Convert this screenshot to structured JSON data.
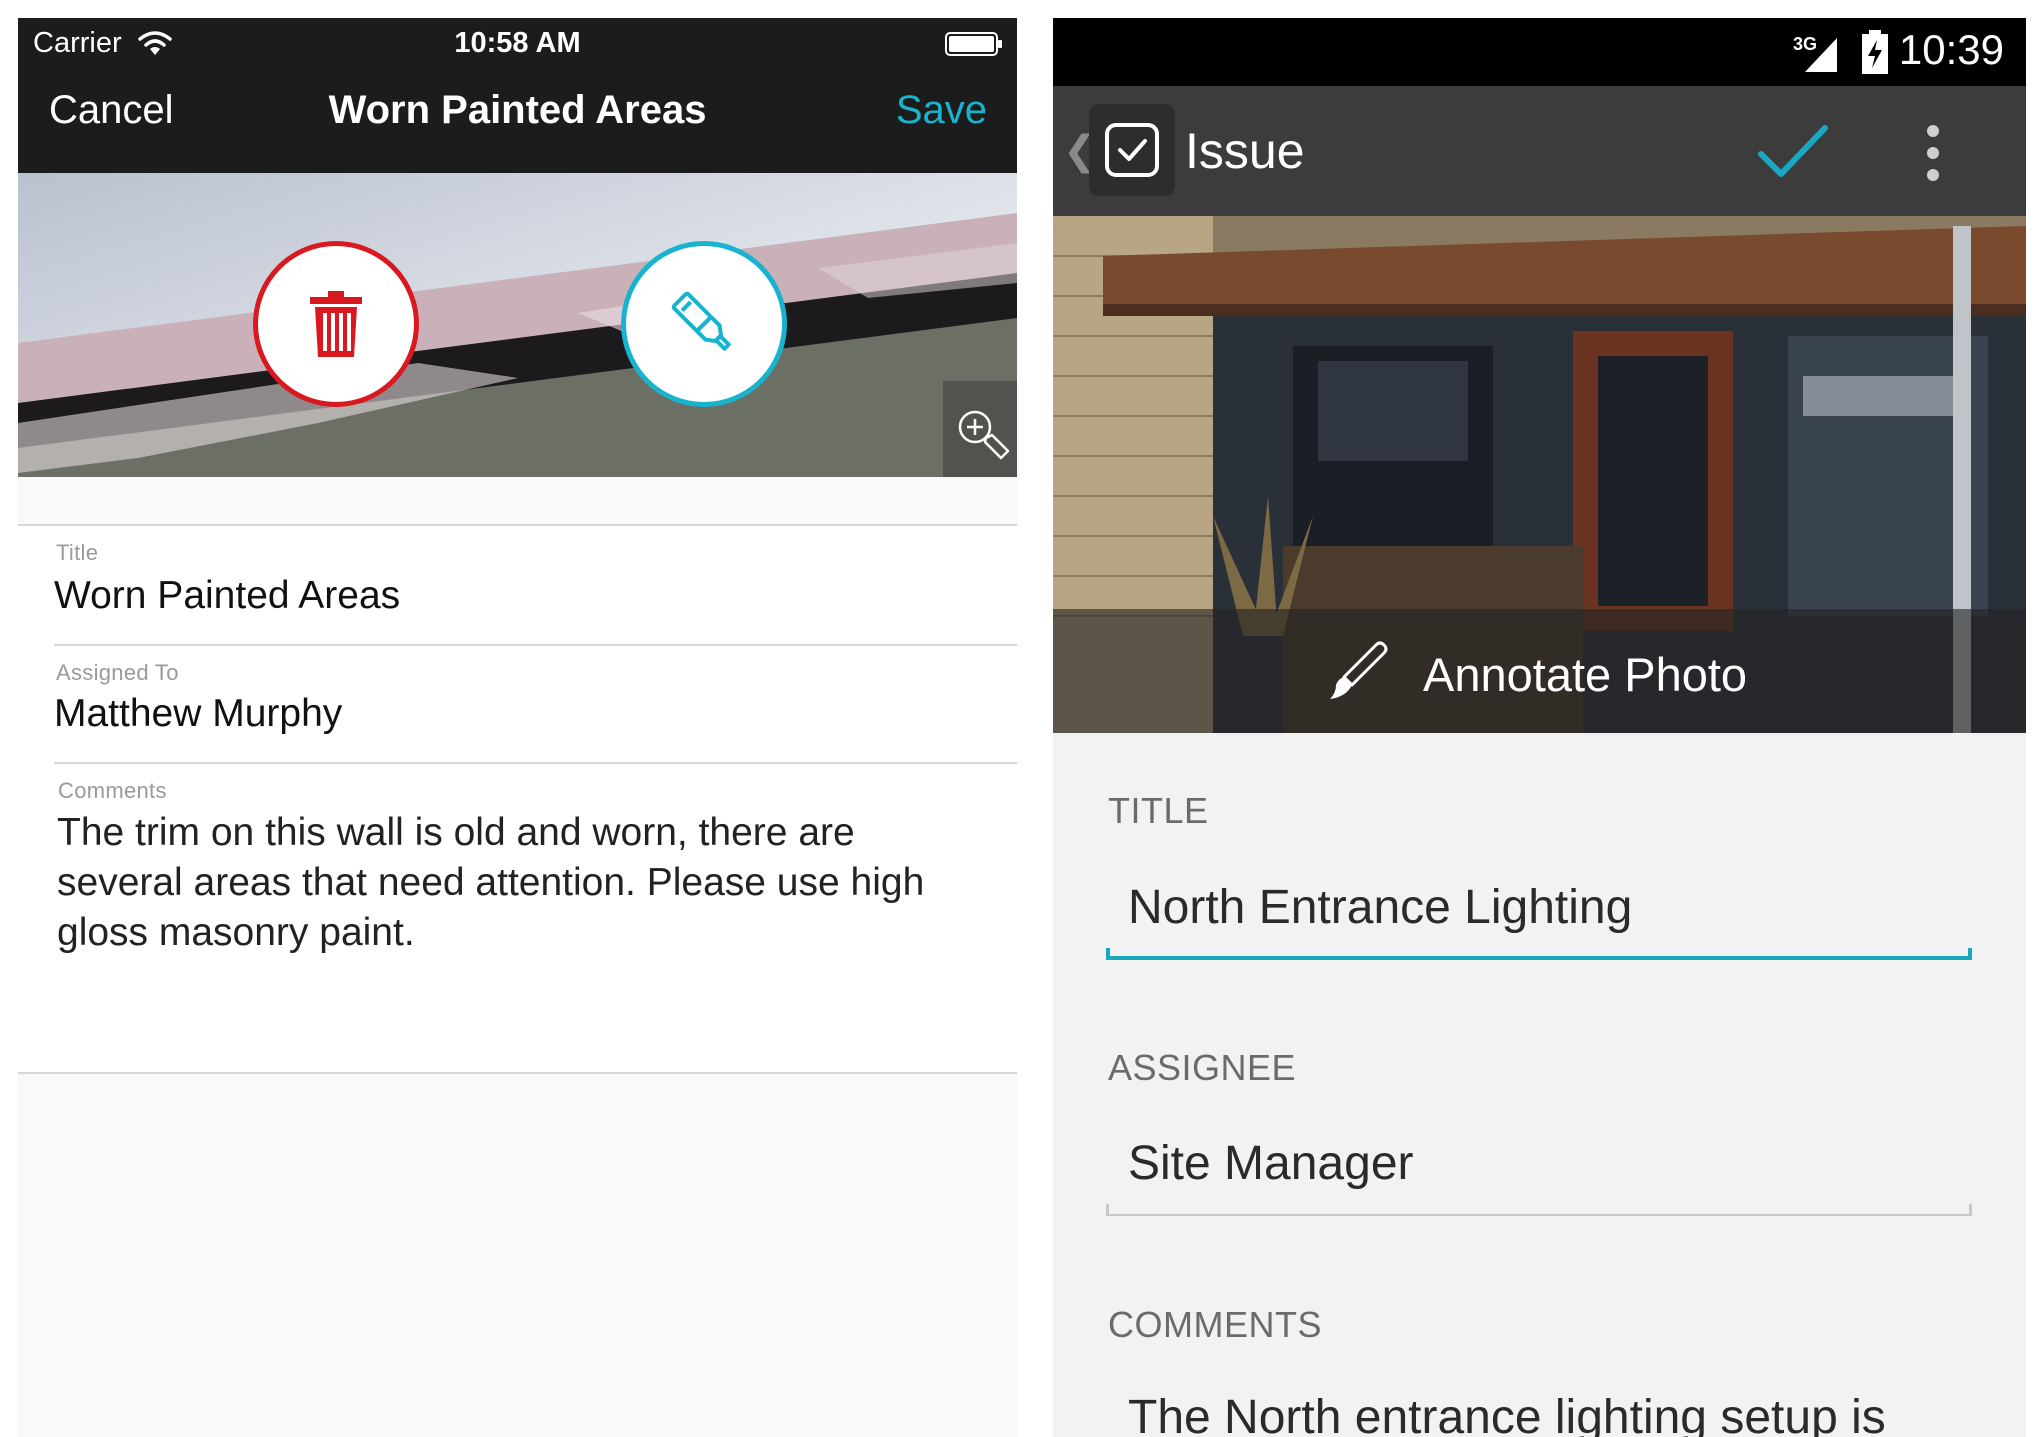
{
  "ios": {
    "status": {
      "carrier": "Carrier",
      "time": "10:58 AM"
    },
    "nav": {
      "cancel": "Cancel",
      "title": "Worn Painted Areas",
      "save": "Save"
    },
    "fields": {
      "title": {
        "label": "Title",
        "value": "Worn Painted Areas"
      },
      "assigned": {
        "label": "Assigned To",
        "value": "Matthew Murphy"
      },
      "comments": {
        "label": "Comments",
        "value": "The trim on this wall is old and worn, there are several areas that need attention. Please use high gloss masonry paint."
      }
    },
    "colors": {
      "accent": "#18b3cf",
      "delete": "#d9191f",
      "navbar": "#1c1c1c"
    },
    "icons": [
      "wifi-icon",
      "battery-icon",
      "trash-icon",
      "marker-icon",
      "zoom-in-icon"
    ]
  },
  "android": {
    "status": {
      "network": "3G",
      "time": "10:39"
    },
    "appbar": {
      "title": "Issue"
    },
    "annotate_label": "Annotate Photo",
    "fields": {
      "title": {
        "label": "TITLE",
        "value": "North Entrance Lighting"
      },
      "assignee": {
        "label": "ASSIGNEE",
        "value": "Site Manager"
      },
      "comments": {
        "label": "COMMENTS",
        "value": "The North entrance lighting setup is"
      }
    },
    "colors": {
      "accent": "#18a8c4",
      "appbar": "#3c3c3c"
    },
    "icons": [
      "signal-icon",
      "battery-charging-icon",
      "back-caret-icon",
      "checkbox-icon",
      "check-icon",
      "more-vert-icon",
      "brush-icon"
    ]
  }
}
